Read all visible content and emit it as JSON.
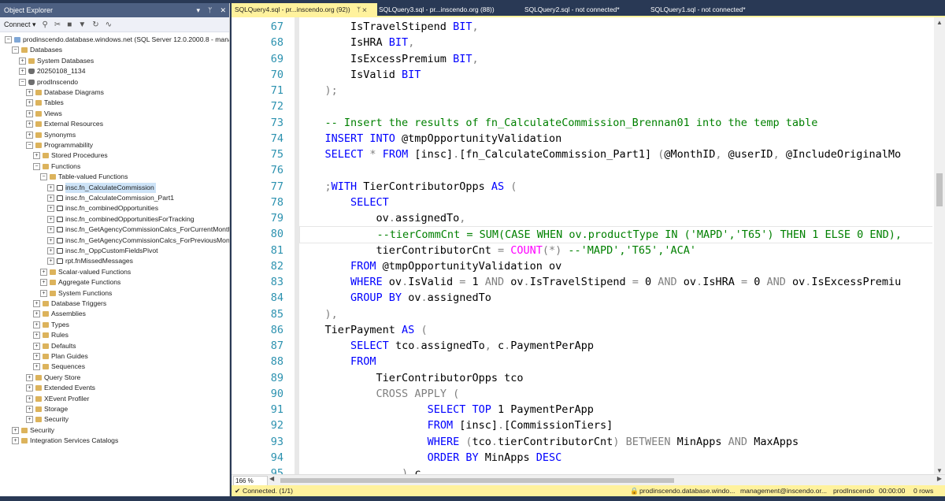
{
  "object_explorer": {
    "title": "Object Explorer",
    "title_controls": [
      "▾",
      "ᛘ",
      "✕"
    ],
    "toolbar": {
      "connect_label": "Connect ▾"
    },
    "tree": [
      {
        "label": "prodinscendo.database.windows.net (SQL Server 12.0.2000.8 - manag",
        "level": 0,
        "exp": "-",
        "icon": "server"
      },
      {
        "label": "Databases",
        "level": 1,
        "exp": "-",
        "icon": "folder"
      },
      {
        "label": "System Databases",
        "level": 2,
        "exp": "+",
        "icon": "folder"
      },
      {
        "label": "20250108_1134",
        "level": 2,
        "exp": "+",
        "icon": "db"
      },
      {
        "label": "prodInscendo",
        "level": 2,
        "exp": "-",
        "icon": "db"
      },
      {
        "label": "Database Diagrams",
        "level": 3,
        "exp": "+",
        "icon": "folder"
      },
      {
        "label": "Tables",
        "level": 3,
        "exp": "+",
        "icon": "folder"
      },
      {
        "label": "Views",
        "level": 3,
        "exp": "+",
        "icon": "folder"
      },
      {
        "label": "External Resources",
        "level": 3,
        "exp": "+",
        "icon": "folder"
      },
      {
        "label": "Synonyms",
        "level": 3,
        "exp": "+",
        "icon": "folder"
      },
      {
        "label": "Programmability",
        "level": 3,
        "exp": "-",
        "icon": "folder"
      },
      {
        "label": "Stored Procedures",
        "level": 4,
        "exp": "+",
        "icon": "folder"
      },
      {
        "label": "Functions",
        "level": 4,
        "exp": "-",
        "icon": "folder"
      },
      {
        "label": "Table-valued Functions",
        "level": 5,
        "exp": "-",
        "icon": "folder"
      },
      {
        "label": "insc.fn_CalculateCommission",
        "level": 6,
        "exp": "+",
        "icon": "fn",
        "selected": true
      },
      {
        "label": "insc.fn_CalculateCommission_Part1",
        "level": 6,
        "exp": "+",
        "icon": "fn"
      },
      {
        "label": "insc.fn_combinedOpportunities",
        "level": 6,
        "exp": "+",
        "icon": "fn"
      },
      {
        "label": "insc.fn_combinedOpportunitiesForTracking",
        "level": 6,
        "exp": "+",
        "icon": "fn"
      },
      {
        "label": "insc.fn_GetAgencyCommissionCalcs_ForCurrentMonth",
        "level": 6,
        "exp": "+",
        "icon": "fn"
      },
      {
        "label": "insc.fn_GetAgencyCommissionCalcs_ForPreviousMonths",
        "level": 6,
        "exp": "+",
        "icon": "fn"
      },
      {
        "label": "insc.fn_OppCustomFieldsPivot",
        "level": 6,
        "exp": "+",
        "icon": "fn"
      },
      {
        "label": "rpt.fnMissedMessages",
        "level": 6,
        "exp": "+",
        "icon": "fn"
      },
      {
        "label": "Scalar-valued Functions",
        "level": 5,
        "exp": "+",
        "icon": "folder"
      },
      {
        "label": "Aggregate Functions",
        "level": 5,
        "exp": "+",
        "icon": "folder"
      },
      {
        "label": "System Functions",
        "level": 5,
        "exp": "+",
        "icon": "folder"
      },
      {
        "label": "Database Triggers",
        "level": 4,
        "exp": "+",
        "icon": "folder"
      },
      {
        "label": "Assemblies",
        "level": 4,
        "exp": "+",
        "icon": "folder"
      },
      {
        "label": "Types",
        "level": 4,
        "exp": "+",
        "icon": "folder"
      },
      {
        "label": "Rules",
        "level": 4,
        "exp": "+",
        "icon": "folder"
      },
      {
        "label": "Defaults",
        "level": 4,
        "exp": "+",
        "icon": "folder"
      },
      {
        "label": "Plan Guides",
        "level": 4,
        "exp": "+",
        "icon": "folder"
      },
      {
        "label": "Sequences",
        "level": 4,
        "exp": "+",
        "icon": "folder"
      },
      {
        "label": "Query Store",
        "level": 3,
        "exp": "+",
        "icon": "folder"
      },
      {
        "label": "Extended Events",
        "level": 3,
        "exp": "+",
        "icon": "folder"
      },
      {
        "label": "XEvent Profiler",
        "level": 3,
        "exp": "+",
        "icon": "folder"
      },
      {
        "label": "Storage",
        "level": 3,
        "exp": "+",
        "icon": "folder"
      },
      {
        "label": "Security",
        "level": 3,
        "exp": "+",
        "icon": "folder"
      },
      {
        "label": "Security",
        "level": 1,
        "exp": "+",
        "icon": "folder"
      },
      {
        "label": "Integration Services Catalogs",
        "level": 1,
        "exp": "+",
        "icon": "folder"
      }
    ]
  },
  "tabs": [
    {
      "label": "SQLQuery4.sql - pr...inscendo.org (92))",
      "pin": "ᛘ ✕",
      "active": true
    },
    {
      "label": "SQLQuery3.sql - pr...inscendo.org (88))",
      "active": false
    },
    {
      "label": "SQLQuery2.sql - not connected*",
      "active": false
    },
    {
      "label": "SQLQuery1.sql - not connected*",
      "active": false
    }
  ],
  "editor": {
    "lines": [
      {
        "n": "67",
        "segs": [
          [
            "        IsTravelStipend ",
            ""
          ],
          [
            "BIT",
            "kw"
          ],
          [
            ",",
            "gr"
          ]
        ]
      },
      {
        "n": "68",
        "segs": [
          [
            "        IsHRA ",
            ""
          ],
          [
            "BIT",
            "kw"
          ],
          [
            ",",
            "gr"
          ]
        ]
      },
      {
        "n": "69",
        "segs": [
          [
            "        IsExcessPremium ",
            ""
          ],
          [
            "BIT",
            "kw"
          ],
          [
            ",",
            "gr"
          ]
        ]
      },
      {
        "n": "70",
        "segs": [
          [
            "        IsValid ",
            ""
          ],
          [
            "BIT",
            "kw"
          ]
        ]
      },
      {
        "n": "71",
        "segs": [
          [
            "    );",
            "gr"
          ]
        ]
      },
      {
        "n": "72",
        "segs": [
          [
            "",
            ""
          ]
        ]
      },
      {
        "n": "73",
        "segs": [
          [
            "    -- Insert the results of fn_CalculateCommission_Brennan01 into the temp table",
            "cm"
          ]
        ]
      },
      {
        "n": "74",
        "segs": [
          [
            "    ",
            ""
          ],
          [
            "INSERT INTO",
            "kw"
          ],
          [
            " @tmpOpportunityValidation",
            ""
          ]
        ]
      },
      {
        "n": "75",
        "segs": [
          [
            "    ",
            ""
          ],
          [
            "SELECT",
            "kw"
          ],
          [
            " * ",
            "gr"
          ],
          [
            "FROM",
            "kw"
          ],
          [
            " [insc]",
            ""
          ],
          [
            ".",
            "gr"
          ],
          [
            "[fn_CalculateCommission_Part1] ",
            ""
          ],
          [
            "(",
            "gr"
          ],
          [
            "@MonthID",
            ""
          ],
          [
            ", ",
            "gr"
          ],
          [
            "@userID",
            ""
          ],
          [
            ", ",
            "gr"
          ],
          [
            "@IncludeOriginalMo",
            ""
          ]
        ]
      },
      {
        "n": "76",
        "segs": [
          [
            "",
            ""
          ]
        ]
      },
      {
        "n": "77",
        "segs": [
          [
            "    ",
            ""
          ],
          [
            ";",
            "gr"
          ],
          [
            "WITH",
            "kw"
          ],
          [
            " TierContributorOpps ",
            ""
          ],
          [
            "AS",
            "kw"
          ],
          [
            " (",
            "gr"
          ]
        ]
      },
      {
        "n": "78",
        "segs": [
          [
            "        ",
            ""
          ],
          [
            "SELECT",
            "kw"
          ]
        ]
      },
      {
        "n": "79",
        "segs": [
          [
            "            ov",
            ""
          ],
          [
            ".",
            "gr"
          ],
          [
            "assignedTo",
            ""
          ],
          [
            ",",
            "gr"
          ]
        ]
      },
      {
        "n": "80",
        "segs": [
          [
            "            --tierCommCnt = SUM(CASE WHEN ov.productType IN ('MAPD','T65') THEN 1 ELSE 0 END),",
            "cm"
          ]
        ],
        "current": true
      },
      {
        "n": "81",
        "segs": [
          [
            "            tierContributorCnt ",
            ""
          ],
          [
            "=",
            "gr"
          ],
          [
            " ",
            ""
          ],
          [
            "COUNT",
            "fu"
          ],
          [
            "(*)",
            "gr"
          ],
          [
            " --'MAPD','T65','ACA'",
            "cm"
          ]
        ]
      },
      {
        "n": "82",
        "segs": [
          [
            "        ",
            ""
          ],
          [
            "FROM",
            "kw"
          ],
          [
            " @tmpOpportunityValidation ov",
            ""
          ]
        ]
      },
      {
        "n": "83",
        "segs": [
          [
            "        ",
            ""
          ],
          [
            "WHERE",
            "kw"
          ],
          [
            " ov",
            ""
          ],
          [
            ".",
            "gr"
          ],
          [
            "IsValid ",
            ""
          ],
          [
            "=",
            "gr"
          ],
          [
            " 1 ",
            ""
          ],
          [
            "AND",
            "gr"
          ],
          [
            " ov",
            ""
          ],
          [
            ".",
            "gr"
          ],
          [
            "IsTravelStipend ",
            ""
          ],
          [
            "=",
            "gr"
          ],
          [
            " 0 ",
            ""
          ],
          [
            "AND",
            "gr"
          ],
          [
            " ov",
            ""
          ],
          [
            ".",
            "gr"
          ],
          [
            "IsHRA ",
            ""
          ],
          [
            "=",
            "gr"
          ],
          [
            " 0 ",
            ""
          ],
          [
            "AND",
            "gr"
          ],
          [
            " ov",
            ""
          ],
          [
            ".",
            "gr"
          ],
          [
            "IsExcessPremiu",
            ""
          ]
        ]
      },
      {
        "n": "84",
        "segs": [
          [
            "        ",
            ""
          ],
          [
            "GROUP BY",
            "kw"
          ],
          [
            " ov",
            ""
          ],
          [
            ".",
            "gr"
          ],
          [
            "assignedTo",
            ""
          ]
        ]
      },
      {
        "n": "85",
        "segs": [
          [
            "    ),",
            "gr"
          ]
        ]
      },
      {
        "n": "86",
        "segs": [
          [
            "    TierPayment ",
            ""
          ],
          [
            "AS",
            "kw"
          ],
          [
            " (",
            "gr"
          ]
        ]
      },
      {
        "n": "87",
        "segs": [
          [
            "        ",
            ""
          ],
          [
            "SELECT",
            "kw"
          ],
          [
            " tco",
            ""
          ],
          [
            ".",
            "gr"
          ],
          [
            "assignedTo",
            ""
          ],
          [
            ",",
            "gr"
          ],
          [
            " c",
            ""
          ],
          [
            ".",
            "gr"
          ],
          [
            "PaymentPerApp",
            ""
          ]
        ]
      },
      {
        "n": "88",
        "segs": [
          [
            "        ",
            ""
          ],
          [
            "FROM",
            "kw"
          ]
        ]
      },
      {
        "n": "89",
        "segs": [
          [
            "            TierContributorOpps tco",
            ""
          ]
        ]
      },
      {
        "n": "90",
        "segs": [
          [
            "            ",
            ""
          ],
          [
            "CROSS APPLY",
            "gr"
          ],
          [
            " (",
            "gr"
          ]
        ]
      },
      {
        "n": "91",
        "segs": [
          [
            "                    ",
            ""
          ],
          [
            "SELECT TOP",
            "kw"
          ],
          [
            " 1 PaymentPerApp",
            ""
          ]
        ]
      },
      {
        "n": "92",
        "segs": [
          [
            "                    ",
            ""
          ],
          [
            "FROM",
            "kw"
          ],
          [
            " [insc]",
            ""
          ],
          [
            ".",
            "gr"
          ],
          [
            "[CommissionTiers]",
            ""
          ]
        ]
      },
      {
        "n": "93",
        "segs": [
          [
            "                    ",
            ""
          ],
          [
            "WHERE",
            "kw"
          ],
          [
            " ",
            ""
          ],
          [
            "(",
            "gr"
          ],
          [
            "tco",
            ""
          ],
          [
            ".",
            "gr"
          ],
          [
            "tierContributorCnt",
            ""
          ],
          [
            ")",
            "gr"
          ],
          [
            " ",
            ""
          ],
          [
            "BETWEEN",
            "gr"
          ],
          [
            " MinApps ",
            ""
          ],
          [
            "AND",
            "gr"
          ],
          [
            " MaxApps",
            ""
          ]
        ]
      },
      {
        "n": "94",
        "segs": [
          [
            "                    ",
            ""
          ],
          [
            "ORDER BY",
            "kw"
          ],
          [
            " MinApps ",
            ""
          ],
          [
            "DESC",
            "kw"
          ]
        ]
      },
      {
        "n": "95",
        "segs": [
          [
            "                ",
            ""
          ],
          [
            ")",
            "gr"
          ],
          [
            " c",
            ""
          ]
        ]
      }
    ]
  },
  "zoom": "166 %",
  "status": {
    "connected": "Connected. (1/1)",
    "server": "prodinscendo.database.windo...",
    "user": "management@inscendo.or...",
    "database": "prodInscendo",
    "elapsed": "00:00:00",
    "rows": "0 rows"
  },
  "colors": {
    "accent_yellow": "#fff29d",
    "frame": "#293955",
    "keyword": "#0000ff",
    "comment": "#008000",
    "gray": "#808080",
    "function": "#ff00ff"
  }
}
